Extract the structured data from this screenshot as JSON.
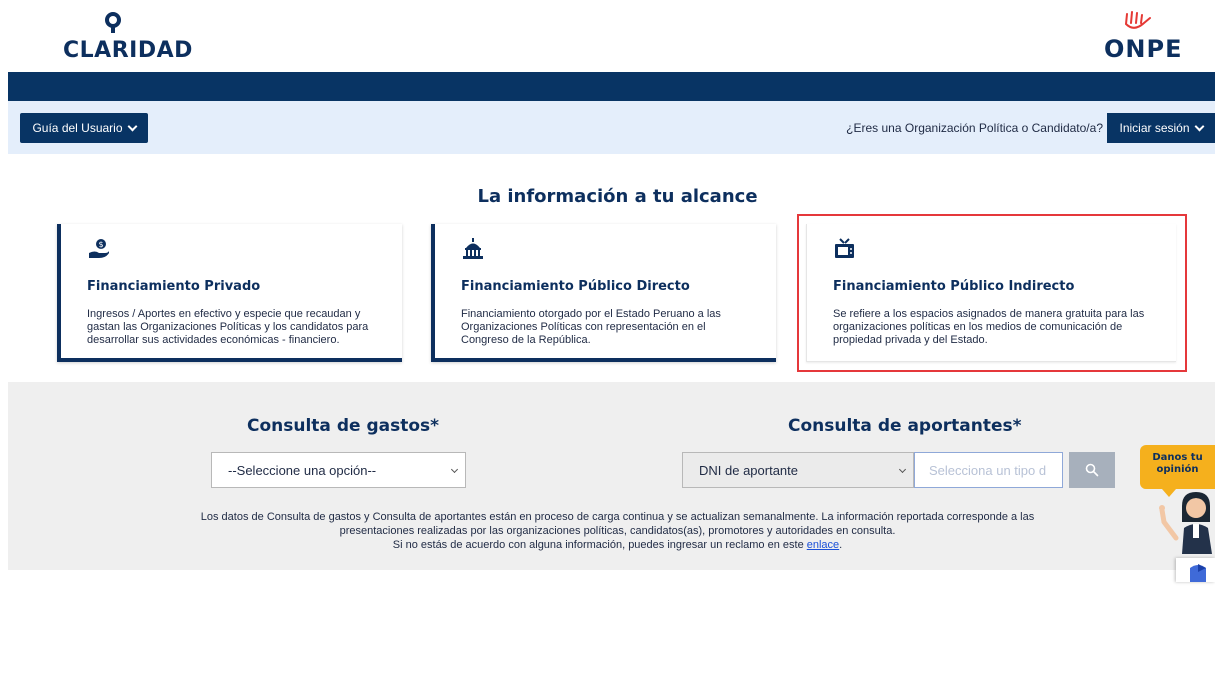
{
  "header": {
    "left_logo_text": "CLARIDAD",
    "right_logo_text": "ONPE"
  },
  "toolbar": {
    "guide_label": "Guía del Usuario",
    "question": "¿Eres una Organización Política o Candidato/a?",
    "login_label": "Iniciar sesión"
  },
  "hero": {
    "title": "La información a tu alcance",
    "cards": [
      {
        "icon": "money-hand-icon",
        "title": "Financiamiento Privado",
        "description": "Ingresos / Aportes en efectivo y especie que recaudan y gastan las Organizaciones Políticas y los candidatos para desarrollar sus actividades económicas - financiero."
      },
      {
        "icon": "capitol-building-icon",
        "title": "Financiamiento Público Directo",
        "description": "Financiamiento otorgado por el Estado Peruano a las Organizaciones Políticas con representación en el Congreso de la República."
      },
      {
        "icon": "television-icon",
        "title": "Financiamiento Público Indirecto",
        "description": "Se refiere a los espacios asignados de manera gratuita para las organizaciones políticas en los medios de comunicación de propiedad privada y del Estado."
      }
    ]
  },
  "consulta": {
    "gastos_title": "Consulta de gastos*",
    "gastos_select": "--Seleccione una opción--",
    "aportantes_title": "Consulta de aportantes*",
    "aportantes_select": "DNI de aportante",
    "aportantes_placeholder": "Selecciona un tipo d",
    "notice_line1": "Los datos de Consulta de gastos y Consulta de aportantes están en proceso de carga continua y se actualizan semanalmente. La información reportada corresponde a las",
    "notice_line2": "presentaciones realizadas por las organizaciones políticas, candidatos(as), promotores y autoridades en consulta.",
    "notice_line3": "Si no estás de acuerdo con alguna información, puedes ingresar un reclamo en este",
    "notice_link": "enlace",
    "notice_end": "."
  },
  "feedback": {
    "line1": "Danos tu",
    "line2": "opinión"
  },
  "colors": {
    "navy": "#083464",
    "light_band": "#e4eefb",
    "gray_section": "#efefef",
    "highlight": "#e5383b",
    "feedback": "#f5b01d"
  }
}
